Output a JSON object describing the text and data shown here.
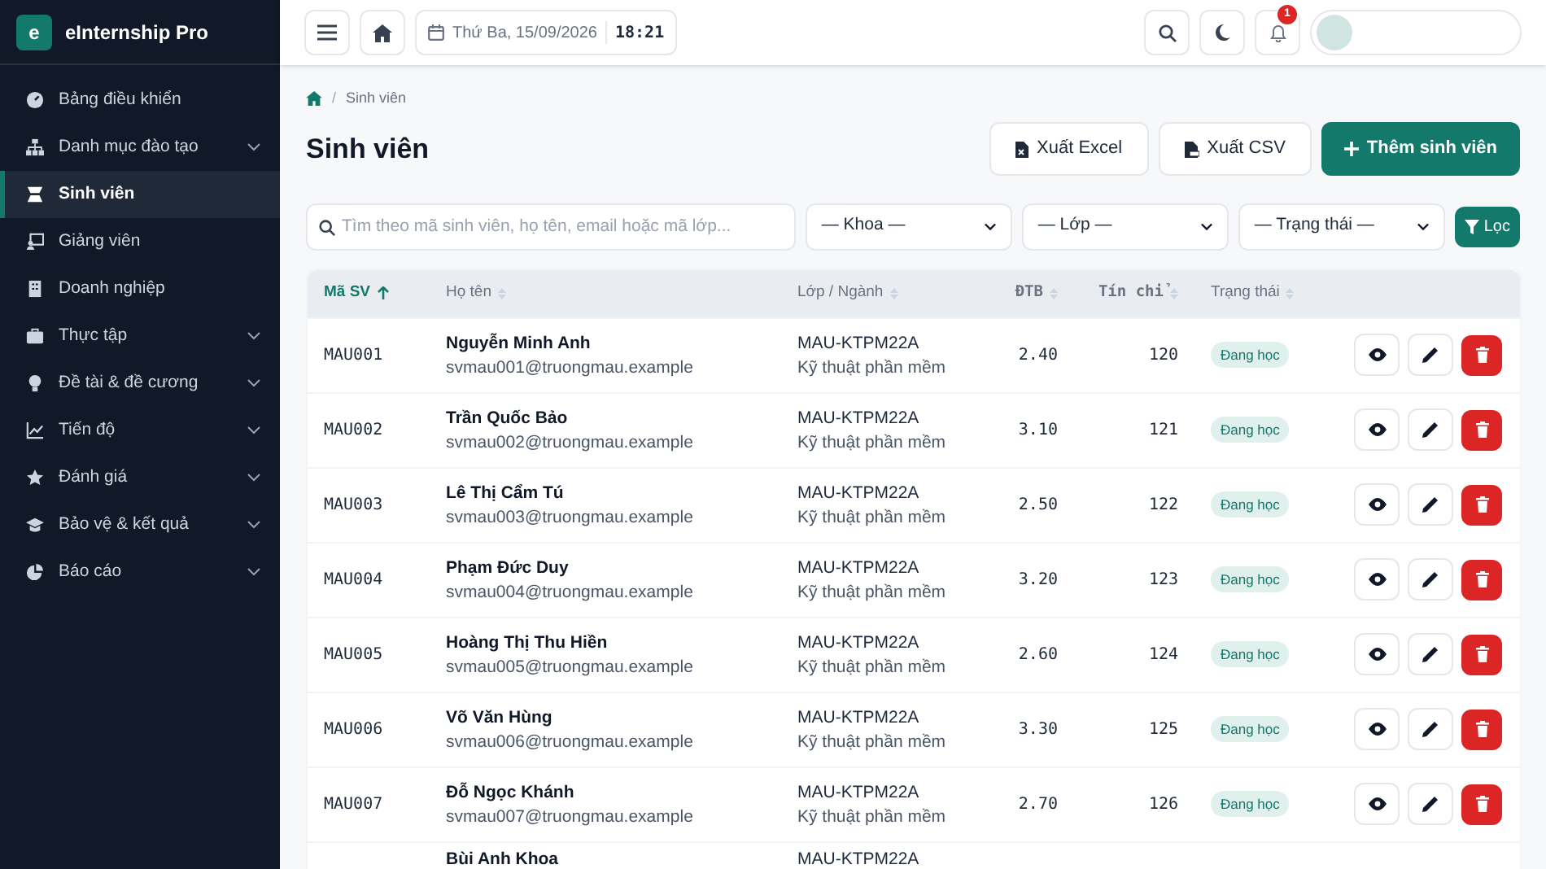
{
  "app": {
    "logo_letter": "e",
    "name": "eInternship Pro"
  },
  "sidebar": {
    "items": [
      {
        "label": "Bảng điều khiển",
        "expandable": false,
        "selected": false
      },
      {
        "label": "Danh mục đào tạo",
        "expandable": true,
        "selected": false
      },
      {
        "label": "Sinh viên",
        "expandable": false,
        "selected": true
      },
      {
        "label": "Giảng viên",
        "expandable": false,
        "selected": false
      },
      {
        "label": "Doanh nghiệp",
        "expandable": false,
        "selected": false
      },
      {
        "label": "Thực tập",
        "expandable": true,
        "selected": false
      },
      {
        "label": "Đề tài & đề cương",
        "expandable": true,
        "selected": false
      },
      {
        "label": "Tiến độ",
        "expandable": true,
        "selected": false
      },
      {
        "label": "Đánh giá",
        "expandable": true,
        "selected": false
      },
      {
        "label": "Bảo vệ & kết quả",
        "expandable": true,
        "selected": false
      },
      {
        "label": "Báo cáo",
        "expandable": true,
        "selected": false
      }
    ]
  },
  "topbar": {
    "date": "Thứ Ba, 15/09/2026",
    "time": "18:21",
    "notification_count": "1"
  },
  "breadcrumb": {
    "separator": "/",
    "current": "Sinh viên"
  },
  "page_title": "Sinh viên",
  "actions": [
    {
      "label": "Xuất Excel",
      "kind": "excel"
    },
    {
      "label": "Xuất CSV",
      "kind": "csv"
    },
    {
      "label": "Thêm sinh viên",
      "kind": "primary"
    }
  ],
  "filters": {
    "search_placeholder": "Tìm theo mã sinh viên, họ tên, email hoặc mã lớp...",
    "selects": [
      "— Khoa —",
      "— Lớp —",
      "— Trạng thái —"
    ],
    "button": "Lọc"
  },
  "table": {
    "columns": [
      {
        "label": "Mã SV",
        "sorted": true
      },
      {
        "label": "Họ tên",
        "sorted": false
      },
      {
        "label": "Lớp / Ngành",
        "sorted": false
      },
      {
        "label": "ĐTB",
        "sorted": false
      },
      {
        "label": "Tín chỉ",
        "sorted": false
      },
      {
        "label": "Trạng thái",
        "sorted": false
      }
    ],
    "rows": [
      {
        "code": "MAU001",
        "name": "Nguyễn Minh Anh",
        "email": "svmau001@truongmau.example",
        "class": "MAU-KTPM22A",
        "major": "Kỹ thuật phần mềm",
        "gpa": "2.40",
        "credits": "120",
        "status": "Đang học"
      },
      {
        "code": "MAU002",
        "name": "Trần Quốc Bảo",
        "email": "svmau002@truongmau.example",
        "class": "MAU-KTPM22A",
        "major": "Kỹ thuật phần mềm",
        "gpa": "3.10",
        "credits": "121",
        "status": "Đang học"
      },
      {
        "code": "MAU003",
        "name": "Lê Thị Cẩm Tú",
        "email": "svmau003@truongmau.example",
        "class": "MAU-KTPM22A",
        "major": "Kỹ thuật phần mềm",
        "gpa": "2.50",
        "credits": "122",
        "status": "Đang học"
      },
      {
        "code": "MAU004",
        "name": "Phạm Đức Duy",
        "email": "svmau004@truongmau.example",
        "class": "MAU-KTPM22A",
        "major": "Kỹ thuật phần mềm",
        "gpa": "3.20",
        "credits": "123",
        "status": "Đang học"
      },
      {
        "code": "MAU005",
        "name": "Hoàng Thị Thu Hiền",
        "email": "svmau005@truongmau.example",
        "class": "MAU-KTPM22A",
        "major": "Kỹ thuật phần mềm",
        "gpa": "2.60",
        "credits": "124",
        "status": "Đang học"
      },
      {
        "code": "MAU006",
        "name": "Võ Văn Hùng",
        "email": "svmau006@truongmau.example",
        "class": "MAU-KTPM22A",
        "major": "Kỹ thuật phần mềm",
        "gpa": "3.30",
        "credits": "125",
        "status": "Đang học"
      },
      {
        "code": "MAU007",
        "name": "Đỗ Ngọc Khánh",
        "email": "svmau007@truongmau.example",
        "class": "MAU-KTPM22A",
        "major": "Kỹ thuật phần mềm",
        "gpa": "2.70",
        "credits": "126",
        "status": "Đang học"
      },
      {
        "name": "Bùi Anh Khoa",
        "class": "MAU-KTPM22A"
      }
    ]
  }
}
